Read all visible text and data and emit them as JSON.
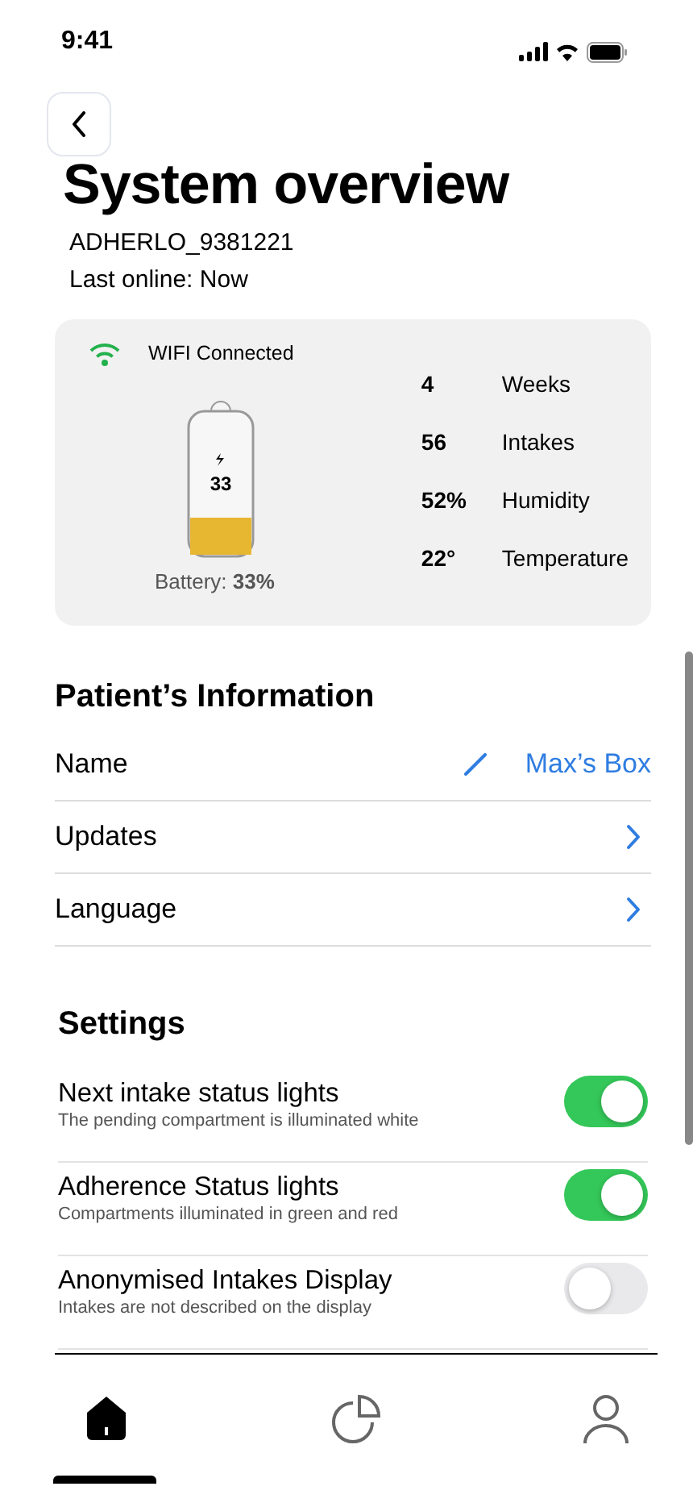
{
  "status_bar": {
    "time": "9:41"
  },
  "header": {
    "title": "System overview",
    "device_id": "ADHERLO_9381221",
    "last_online": "Last online: Now"
  },
  "device_card": {
    "wifi": "WIFI Connected",
    "battery": {
      "reading": "33",
      "caption": "Battery: **33%**"
    },
    "stats": [
      {
        "value": "4",
        "label": "Weeks"
      },
      {
        "value": "56",
        "label": "Intakes"
      },
      {
        "value": "52%",
        "label": "Humidity"
      },
      {
        "value": "22°",
        "label": "Temperature"
      }
    ]
  },
  "patient": {
    "heading": "Patient’s Information",
    "rows": [
      {
        "kind": "edit",
        "label": "Name",
        "value": "Max’s Box"
      },
      {
        "kind": "link",
        "label": "Updates"
      },
      {
        "kind": "link",
        "label": "Language"
      }
    ]
  },
  "settings": {
    "heading": "Settings",
    "items": [
      {
        "title": "Next intake status lights",
        "description": "The pending compartment is illuminated white",
        "on": true
      },
      {
        "title": "Adherence Status lights",
        "description": "Compartments illuminated in green and red",
        "on": true
      },
      {
        "title": "Anonymised Intakes Display",
        "description": "Intakes are not described on the display",
        "on": false
      }
    ]
  },
  "tab_bar": [
    {
      "kind": "home",
      "selected": true
    },
    {
      "kind": "chart",
      "selected": false
    },
    {
      "kind": "profile",
      "selected": false
    }
  ]
}
